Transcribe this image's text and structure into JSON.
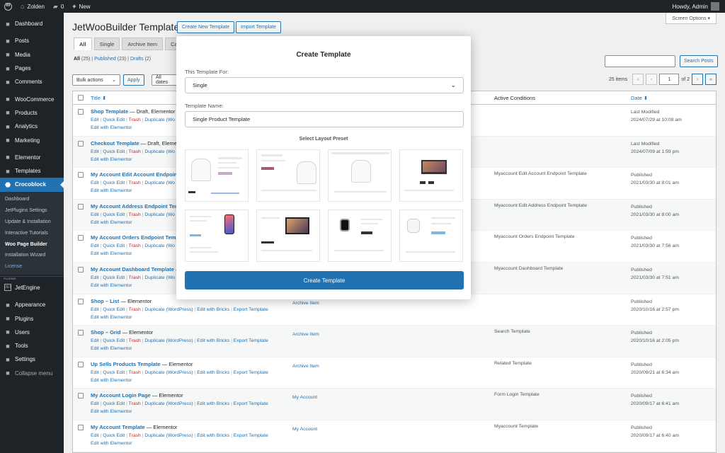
{
  "adminbar": {
    "site_name": "Zolden",
    "comments_count": "0",
    "new_label": "New",
    "howdy": "Howdy, Admin"
  },
  "sidebar": {
    "items_top": [
      {
        "label": "Dashboard",
        "icon": "dashboard-icon"
      }
    ],
    "items_a": [
      {
        "label": "Posts",
        "icon": "pin-icon"
      },
      {
        "label": "Media",
        "icon": "media-icon"
      },
      {
        "label": "Pages",
        "icon": "page-icon"
      },
      {
        "label": "Comments",
        "icon": "comment-icon"
      }
    ],
    "items_b": [
      {
        "label": "WooCommerce",
        "icon": "woo-icon"
      },
      {
        "label": "Products",
        "icon": "box-icon"
      },
      {
        "label": "Analytics",
        "icon": "chart-icon"
      },
      {
        "label": "Marketing",
        "icon": "megaphone-icon"
      }
    ],
    "items_c": [
      {
        "label": "Elementor",
        "icon": "elementor-icon"
      },
      {
        "label": "Templates",
        "icon": "folder-icon"
      }
    ],
    "active": {
      "label": "Crocoblock",
      "icon": "crocoblock-icon"
    },
    "submenu": [
      {
        "label": "Dashboard"
      },
      {
        "label": "JetPlugins Settings"
      },
      {
        "label": "Update & Installation"
      },
      {
        "label": "Interactive Tutorials"
      },
      {
        "label": "Woo Page Builder"
      },
      {
        "label": "Installation Wizard"
      },
      {
        "label": "License"
      }
    ],
    "legacy_tag": "PLUGINS",
    "jetengine": {
      "label": "JetEngine",
      "icon_text": "JET"
    },
    "items_d": [
      {
        "label": "Appearance",
        "icon": "brush-icon"
      },
      {
        "label": "Plugins",
        "icon": "plug-icon"
      },
      {
        "label": "Users",
        "icon": "user-icon"
      },
      {
        "label": "Tools",
        "icon": "wrench-icon"
      },
      {
        "label": "Settings",
        "icon": "settings-icon"
      },
      {
        "label": "Collapse menu",
        "icon": "collapse-icon"
      }
    ]
  },
  "page": {
    "title": "JetWooBuilder Templates",
    "create_new": "Create New Template",
    "import": "Import Template",
    "screen_options": "Screen Options ▾",
    "tabs": [
      "All",
      "Single",
      "Archive Item",
      "Cate"
    ],
    "filters": {
      "all": "All",
      "all_count": "(25)",
      "published": "Published",
      "published_count": "(23)",
      "drafts": "Drafts",
      "drafts_count": "(2)"
    },
    "bulk_actions": "Bulk actions",
    "apply": "Apply",
    "all_dates": "All dates",
    "search_button": "Search Posts",
    "items_count": "25 items",
    "page_current": "1",
    "page_of": "of 2"
  },
  "table": {
    "headers": {
      "title": "Title ⬍",
      "conditions": "Active Conditions",
      "date": "Date ⬍"
    },
    "rows": [
      {
        "title": "Shop Template",
        "suffix": " — Draft, Elementor",
        "type": "",
        "cond": "",
        "status": "Last Modified",
        "date": "2024/07/29 at 10:08 am",
        "short": true
      },
      {
        "title": "Checkout Template",
        "suffix": " — Draft, Elemen",
        "type": "",
        "cond": "",
        "status": "Last Modified",
        "date": "2024/07/09 at 1:59 pm",
        "short": true
      },
      {
        "title": "My Account Edit Account Endpoint",
        "suffix": "",
        "type": "",
        "cond": "Myaccount Edit Account Endpoint Template",
        "status": "Published",
        "date": "2021/03/30 at 8:01 am",
        "short": true
      },
      {
        "title": "My Account Address Endpoint Tem",
        "suffix": "",
        "type": "",
        "cond": "Myaccount Edit Address Endpoint Template",
        "status": "Published",
        "date": "2021/03/30 at 8:00 am",
        "short": true
      },
      {
        "title": "My Account Orders Endpoint Temp",
        "suffix": "",
        "type": "",
        "cond": "Myaccount Orders Endpoint Template",
        "status": "Published",
        "date": "2021/03/30 at 7:56 am",
        "short": true
      },
      {
        "title": "My Account Dashboard Template",
        "suffix": " –",
        "type": "",
        "cond": "Myaccount Dashboard Template",
        "status": "Published",
        "date": "2021/03/30 at 7:51 am",
        "short": true
      },
      {
        "title": "Shop – List",
        "suffix": " — Elementor",
        "type": "Archive Item",
        "cond": "",
        "status": "Published",
        "date": "2020/10/16 at 2:57 pm",
        "short": false
      },
      {
        "title": "Shop – Grid",
        "suffix": " — Elementor",
        "type": "Archive Item",
        "cond": "Search Template",
        "status": "Published",
        "date": "2020/10/16 at 2:05 pm",
        "short": false
      },
      {
        "title": "Up Sells Products Template",
        "suffix": " — Elementor",
        "type": "Archive Item",
        "cond": "Related Template",
        "status": "Published",
        "date": "2020/09/21 at 6:34 am",
        "short": false
      },
      {
        "title": "My Account Login Page",
        "suffix": " — Elementor",
        "type": "My Account",
        "cond": "Form Login Template",
        "status": "Published",
        "date": "2020/09/17 at 6:41 am",
        "short": false
      },
      {
        "title": "My Account Template",
        "suffix": " — Elementor",
        "type": "My Account",
        "cond": "Myaccount Template",
        "status": "Published",
        "date": "2020/09/17 at 6:40 am",
        "short": false
      }
    ],
    "actions": {
      "edit": "Edit",
      "quick_edit": "Quick Edit",
      "trash": "Trash",
      "duplicate": "Duplicate (WordPress)",
      "duplicate_short": "Duplicate (Wo",
      "bricks": "Edit with Bricks",
      "export": "Export Template",
      "elementor": "Edit with Elementor"
    }
  },
  "modal": {
    "title": "Create Template",
    "for_label": "This Template For:",
    "for_value": "Single",
    "name_label": "Template Name:",
    "name_value": "Single Product Template",
    "preset_title": "Select Layout Preset",
    "button": "Create Template"
  },
  "colors": {
    "accent": "#2271b1",
    "sidebar": "#1d2327",
    "trash": "#b32d2e"
  }
}
